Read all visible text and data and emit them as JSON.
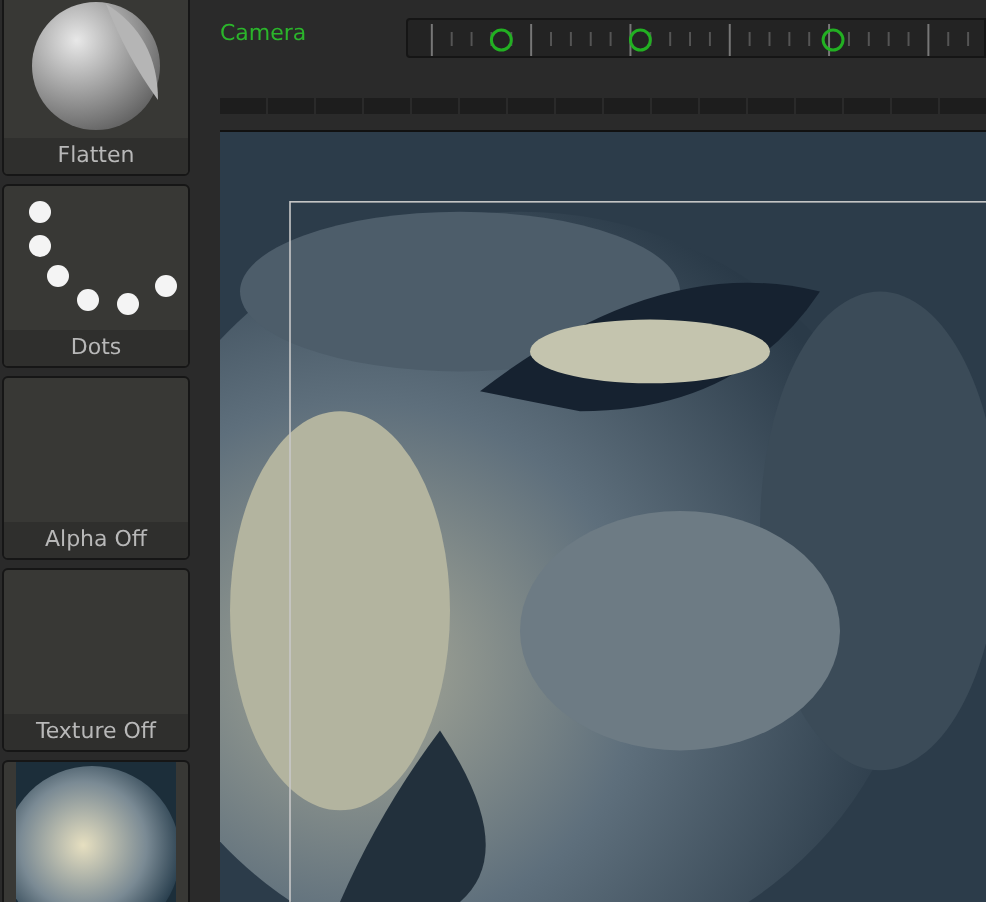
{
  "tools": [
    {
      "kind": "brush",
      "label": "Flatten"
    },
    {
      "kind": "stroke",
      "label": "Dots"
    },
    {
      "kind": "empty",
      "label": "Alpha Off"
    },
    {
      "kind": "empty",
      "label": "Texture Off"
    },
    {
      "kind": "material"
    }
  ],
  "timeline": {
    "label": "Camera"
  }
}
